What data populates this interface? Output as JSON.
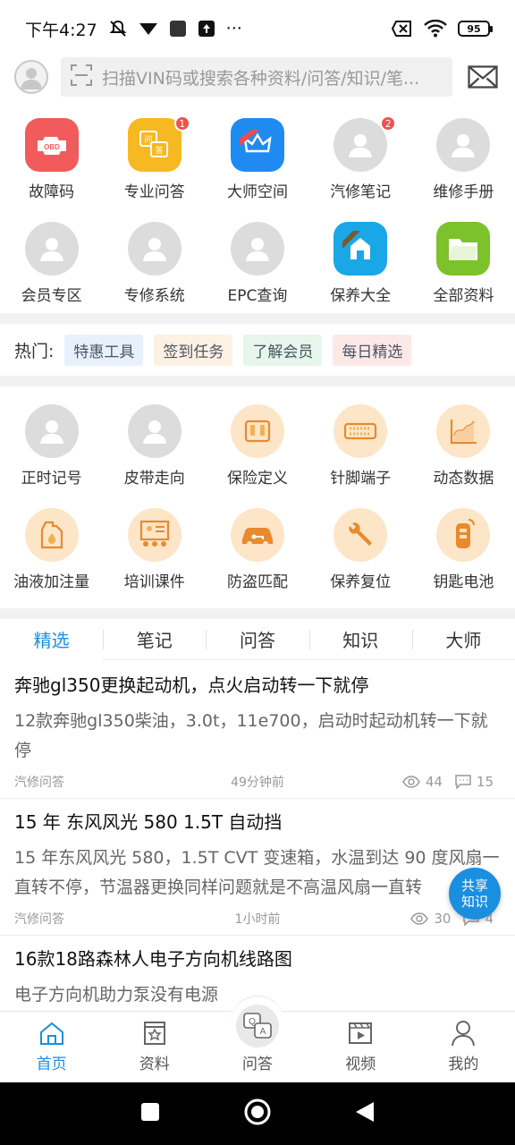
{
  "status_bar": {
    "time": "下午4:27",
    "dots": "···",
    "battery": "95"
  },
  "header": {
    "search_placeholder": "扫描VIN码或搜索各种资料/问答/知识/笔..."
  },
  "grid_top": [
    {
      "label": "故障码",
      "icon": "obd-icon",
      "color": "#f25b5b",
      "badge": ""
    },
    {
      "label": "专业问答",
      "icon": "qa-icon",
      "color": "#f7b922",
      "badge": "1"
    },
    {
      "label": "大师空间",
      "icon": "master-crown-icon",
      "color": "#1f8bf0",
      "badge": ""
    },
    {
      "label": "汽修笔记",
      "icon": "default-avatar-icon",
      "color": "#dcdcdc",
      "badge": "2"
    },
    {
      "label": "维修手册",
      "icon": "default-avatar-icon",
      "color": "#dcdcdc",
      "badge": ""
    },
    {
      "label": "会员专区",
      "icon": "default-avatar-icon",
      "color": "#dcdcdc",
      "badge": ""
    },
    {
      "label": "专修系统",
      "icon": "default-avatar-icon",
      "color": "#dcdcdc",
      "badge": ""
    },
    {
      "label": "EPC查询",
      "icon": "default-avatar-icon",
      "color": "#dcdcdc",
      "badge": ""
    },
    {
      "label": "保养大全",
      "icon": "vip-house-icon",
      "color": "#1aa7e8",
      "badge": ""
    },
    {
      "label": "全部资料",
      "icon": "folder-icon",
      "color": "#7cc22a",
      "badge": ""
    }
  ],
  "hot": {
    "label": "热门:",
    "chips": [
      {
        "text": "特惠工具",
        "bg": "#e8f1fb"
      },
      {
        "text": "签到任务",
        "bg": "#fdf1e4"
      },
      {
        "text": "了解会员",
        "bg": "#e7f6ec"
      },
      {
        "text": "每日精选",
        "bg": "#fde8e8"
      }
    ]
  },
  "grid_tools": [
    {
      "label": "正时记号",
      "icon": "default-avatar-icon"
    },
    {
      "label": "皮带走向",
      "icon": "default-avatar-icon"
    },
    {
      "label": "保险定义",
      "icon": "fuse-box-icon"
    },
    {
      "label": "针脚端子",
      "icon": "connector-icon"
    },
    {
      "label": "动态数据",
      "icon": "chart-icon"
    },
    {
      "label": "油液加注量",
      "icon": "oil-can-icon"
    },
    {
      "label": "培训课件",
      "icon": "training-icon"
    },
    {
      "label": "防盗匹配",
      "icon": "car-key-icon"
    },
    {
      "label": "保养复位",
      "icon": "wrench-icon"
    },
    {
      "label": "钥匙电池",
      "icon": "key-fob-icon"
    }
  ],
  "tabs": [
    "精选",
    "笔记",
    "问答",
    "知识",
    "大师"
  ],
  "posts": [
    {
      "title": "奔驰gl350更换起动机，点火启动转一下就停",
      "body": "12款奔驰gl350柴油，3.0t，11e700，启动时起动机转一下就停",
      "source": "汽修问答",
      "time": "49分钟前",
      "views": "44",
      "comments": "15"
    },
    {
      "title": "15 年 东风风光 580 1.5T 自动挡",
      "body": "15 年东风风光 580，1.5T CVT 变速箱，水温到达 90 度风扇一直转不停，节温器更换同样问题就是不高温风扇一直转",
      "source": "汽修问答",
      "time": "1小时前",
      "views": "30",
      "comments": "4"
    },
    {
      "title": "16款18路森林人电子方向机线路图",
      "body": "电子方向机助力泵没有电源",
      "source": "",
      "time": "",
      "views": "",
      "comments": ""
    }
  ],
  "fab": {
    "line1": "共享",
    "line2": "知识"
  },
  "bottom_nav": [
    {
      "label": "首页",
      "icon": "home-icon"
    },
    {
      "label": "资料",
      "icon": "document-icon"
    },
    {
      "label": "问答",
      "icon": "qa-bubble-icon"
    },
    {
      "label": "视频",
      "icon": "video-icon"
    },
    {
      "label": "我的",
      "icon": "profile-icon"
    }
  ],
  "colors": {
    "accent": "#1a8fe0",
    "badge": "#f0524a",
    "divider": "#f1f1f1"
  }
}
